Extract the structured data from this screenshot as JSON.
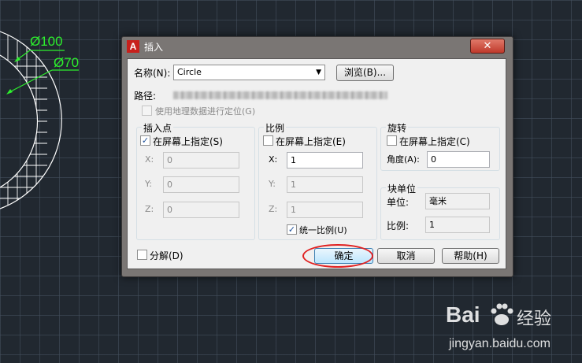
{
  "canvas": {
    "background": "#212830",
    "dimension_color": "#2df02d",
    "dim_labels": [
      "Ø100",
      "Ø70"
    ]
  },
  "dialog": {
    "title": "插入",
    "app_icon": "autocad-logo-icon",
    "close_icon": "close-icon",
    "name_label": "名称(N):",
    "name_value": "Circle",
    "browse_label": "浏览(B)...",
    "path_label": "路径:",
    "geo_label": "使用地理数据进行定位(G)",
    "insertion": {
      "title": "插入点",
      "onscreen_label": "在屏幕上指定(S)",
      "onscreen_checked": true,
      "x_label": "X:",
      "x_value": "0",
      "y_label": "Y:",
      "y_value": "0",
      "z_label": "Z:",
      "z_value": "0"
    },
    "scale": {
      "title": "比例",
      "onscreen_label": "在屏幕上指定(E)",
      "onscreen_checked": false,
      "x_label": "X:",
      "x_value": "1",
      "y_label": "Y:",
      "y_value": "1",
      "z_label": "Z:",
      "z_value": "1",
      "uniform_label": "统一比例(U)",
      "uniform_checked": true
    },
    "rotation": {
      "title": "旋转",
      "onscreen_label": "在屏幕上指定(C)",
      "onscreen_checked": false,
      "angle_label": "角度(A):",
      "angle_value": "0"
    },
    "block_unit": {
      "title": "块单位",
      "unit_label": "单位:",
      "unit_value": "毫米",
      "factor_label": "比例:",
      "factor_value": "1"
    },
    "explode_label": "分解(D)",
    "explode_checked": false,
    "ok_label": "确定",
    "cancel_label": "取消",
    "help_label": "帮助(H)",
    "highlight_color": "#e02020"
  },
  "watermark": {
    "brand_text": "Bai",
    "brand_suffix": "经验",
    "url": "jingyan.baidu.com",
    "paw_icon": "baidu-paw-icon"
  }
}
